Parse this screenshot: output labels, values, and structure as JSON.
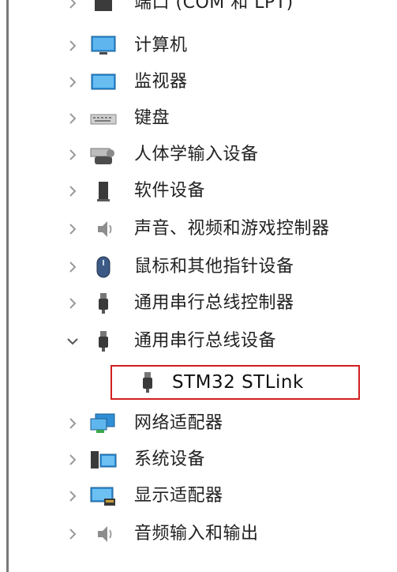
{
  "tree": {
    "items": [
      {
        "label": "端口 (COM 和 LPT)",
        "icon": "port-icon",
        "expanded": false
      },
      {
        "label": "计算机",
        "icon": "computer-icon",
        "expanded": false
      },
      {
        "label": "监视器",
        "icon": "monitor-icon",
        "expanded": false
      },
      {
        "label": "键盘",
        "icon": "keyboard-icon",
        "expanded": false
      },
      {
        "label": "人体学输入设备",
        "icon": "hid-icon",
        "expanded": false
      },
      {
        "label": "软件设备",
        "icon": "software-device-icon",
        "expanded": false
      },
      {
        "label": "声音、视频和游戏控制器",
        "icon": "speaker-icon",
        "expanded": false
      },
      {
        "label": "鼠标和其他指针设备",
        "icon": "mouse-icon",
        "expanded": false
      },
      {
        "label": "通用串行总线控制器",
        "icon": "usb-icon",
        "expanded": false
      },
      {
        "label": "通用串行总线设备",
        "icon": "usb-icon",
        "expanded": true,
        "children": [
          {
            "label": "STM32 STLink",
            "icon": "usb-icon",
            "highlighted": true
          }
        ]
      },
      {
        "label": "网络适配器",
        "icon": "network-adapter-icon",
        "expanded": false
      },
      {
        "label": "系统设备",
        "icon": "system-device-icon",
        "expanded": false
      },
      {
        "label": "显示适配器",
        "icon": "display-adapter-icon",
        "expanded": false
      },
      {
        "label": "音频输入和输出",
        "icon": "speaker-icon",
        "expanded": false
      }
    ]
  },
  "colors": {
    "highlight_border": "#d21f1f",
    "chevron": "#9a9a9a"
  }
}
